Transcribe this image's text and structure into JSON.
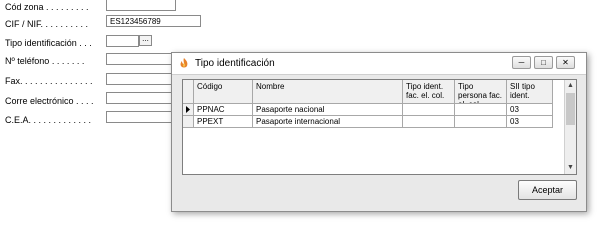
{
  "form": {
    "fields": [
      {
        "label": "Cód zona . . . . . . . . .",
        "value": ""
      },
      {
        "label": "CIF / NIF. . . . . . . . . .",
        "value": "ES123456789"
      },
      {
        "label": "Tipo identificación . . .",
        "value": ""
      },
      {
        "label": "Nº teléfono . . . . . . .",
        "value": ""
      },
      {
        "label": "Fax. . . . . . . . . . . . . . .",
        "value": ""
      },
      {
        "label": "Corre electrónico . . . .",
        "value": ""
      },
      {
        "label": "C.E.A. . . . . . . . . . . . .",
        "value": ""
      }
    ],
    "lookup_button_label": "..."
  },
  "dialog": {
    "title": "Tipo identificación",
    "title_icon": "flame-app-icon",
    "columns": [
      "Código",
      "Nombre",
      "Tipo ident. fac. el. col.",
      "Tipo persona fac. el. col.",
      "SII tipo ident."
    ],
    "rows": [
      {
        "codigo": "PPNAC",
        "nombre": "Pasaporte nacional",
        "tipo_ident": "",
        "tipo_persona": "",
        "sii": "03"
      },
      {
        "codigo": "PPEXT",
        "nombre": "Pasaporte internacional",
        "tipo_ident": "",
        "tipo_persona": "",
        "sii": "03"
      }
    ],
    "accept_label": "Aceptar"
  }
}
